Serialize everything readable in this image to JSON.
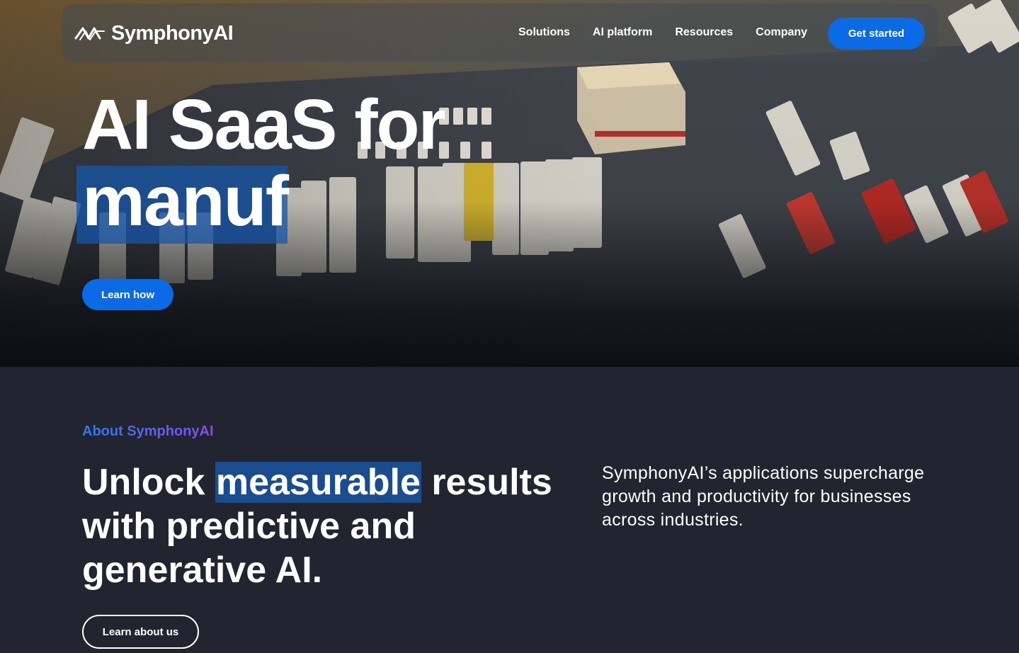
{
  "header": {
    "logo_text": "SymphonyAI",
    "nav": [
      "Solutions",
      "AI platform",
      "Resources",
      "Company"
    ],
    "cta": "Get started"
  },
  "hero": {
    "title_line1": "AI SaaS for",
    "title_line2": "manuf",
    "button": "Learn how"
  },
  "about": {
    "kicker": "About SymphonyAI",
    "heading_pre": "Unlock ",
    "heading_mark": "measurable",
    "heading_post": " results with predictive and generative AI.",
    "description": "SymphonyAI’s applications supercharge growth and productivity for businesses across industries.",
    "button": "Learn about us"
  },
  "colors": {
    "primary": "#0b6ae6",
    "background": "#22252f",
    "highlight": "#1a4d8f"
  }
}
